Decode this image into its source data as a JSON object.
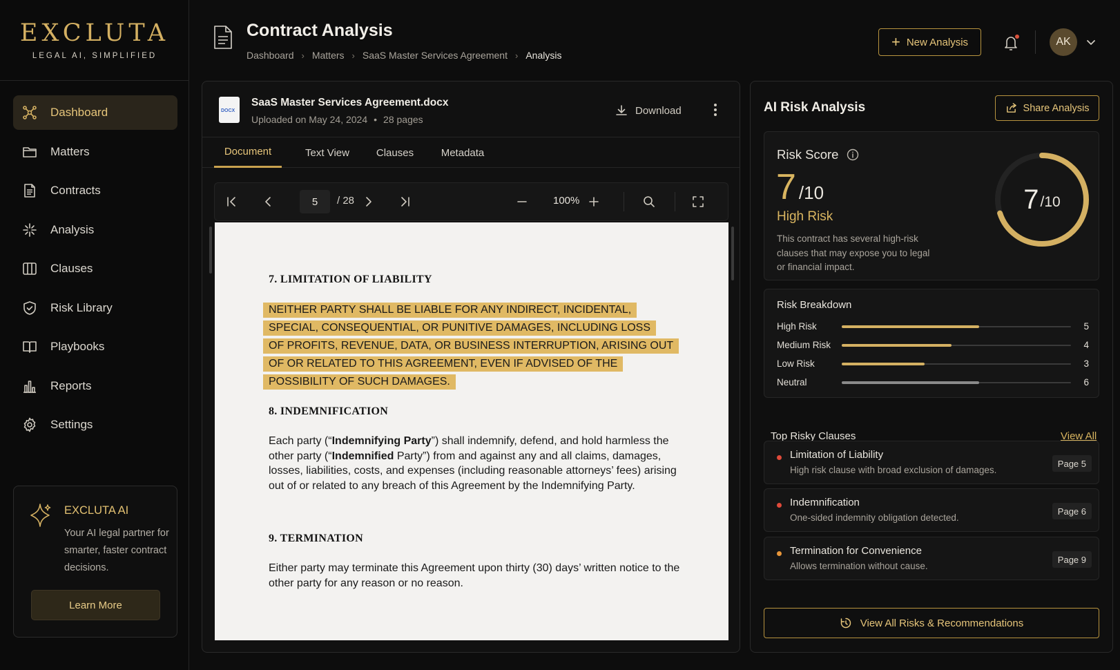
{
  "brand": {
    "name": "EXCLUTA",
    "tagline": "LEGAL AI, SIMPLIFIED"
  },
  "sidebar": {
    "items": [
      {
        "label": "Dashboard",
        "icon": "dashboard-icon",
        "active": true
      },
      {
        "label": "Matters",
        "icon": "folder-icon"
      },
      {
        "label": "Contracts",
        "icon": "document-icon"
      },
      {
        "label": "Analysis",
        "icon": "sparkle-icon"
      },
      {
        "label": "Clauses",
        "icon": "columns-icon"
      },
      {
        "label": "Risk Library",
        "icon": "shield-icon"
      },
      {
        "label": "Playbooks",
        "icon": "book-icon"
      },
      {
        "label": "Reports",
        "icon": "bar-chart-icon"
      },
      {
        "label": "Settings",
        "icon": "gear-icon"
      }
    ],
    "promo": {
      "title": "EXCLUTA AI",
      "text": "Your AI legal partner for smarter, faster contract decisions.",
      "button": "Learn More"
    }
  },
  "header": {
    "title": "Contract Analysis",
    "breadcrumb": [
      "Dashboard",
      "Matters",
      "SaaS Master Services Agreement",
      "Analysis"
    ],
    "new_button": "New Analysis",
    "avatar_initials": "AK"
  },
  "document": {
    "file_name": "SaaS Master Services Agreement.docx",
    "file_type": "DOCX",
    "uploaded": "Uploaded on May 24, 2024",
    "pages": "28 pages",
    "download_label": "Download",
    "tabs": [
      "Document",
      "Text View",
      "Clauses",
      "Metadata"
    ],
    "active_tab": "Document",
    "pager": {
      "current_page": "5",
      "total": "/ 28",
      "zoom": "100%"
    },
    "content": {
      "s7_heading": "7. LIMITATION OF LIABILITY",
      "s7_highlight": [
        "NEITHER PARTY SHALL BE LIABLE FOR ANY INDIRECT, INCIDENTAL,",
        "SPECIAL, CONSEQUENTIAL, OR PUNITIVE DAMAGES, INCLUDING LOSS",
        "OF PROFITS, REVENUE, DATA, OR BUSINESS INTERRUPTION, ARISING OUT",
        "OF OR RELATED TO THIS AGREEMENT, EVEN IF ADVISED OF THE",
        "POSSIBILITY OF SUCH DAMAGES."
      ],
      "s8_heading": "8. INDEMNIFICATION",
      "s8_p1": "Each party (“",
      "s8_b1": "Indemnifying Party",
      "s8_p2": "”) shall indemnify, defend, and hold harmless the other party (“",
      "s8_b2": "Indemnified",
      "s8_p3": " Party”) from and against any and all claims, damages, losses, liabilities, costs, and expenses (including reasonable attorneys’ fees) arising out of or related to any breach of this Agreement by the Indemnifying Party.",
      "s9_heading": "9. TERMINATION",
      "s9_text": "Either party may terminate this Agreement upon thirty (30) days’ written notice to the other party for any reason or no reason."
    }
  },
  "risk": {
    "title": "AI Risk Analysis",
    "share_button": "Share Analysis",
    "score_label": "Risk Score",
    "score": "7",
    "score_max": "/10",
    "score_value": 7,
    "score_total": 10,
    "level": "High Risk",
    "description": "This contract has several high-risk clauses that may expose you to legal or financial impact.",
    "breakdown_title": "Risk Breakdown",
    "breakdown": [
      {
        "label": "High Risk",
        "value": "5",
        "fraction": 0.6,
        "color": "#d4b062"
      },
      {
        "label": "Medium Risk",
        "value": "4",
        "fraction": 0.48,
        "color": "#d4b062"
      },
      {
        "label": "Low Risk",
        "value": "3",
        "fraction": 0.36,
        "color": "#d4b062"
      },
      {
        "label": "Neutral",
        "value": "6",
        "fraction": 0.6,
        "color": "#8a8a8a"
      }
    ],
    "top_title": "Top Risky Clauses",
    "view_all": "View All",
    "clauses": [
      {
        "title": "Limitation of Liability",
        "desc": "High risk clause with broad exclusion of damages.",
        "page": "Page 5",
        "color": "#e04a3a"
      },
      {
        "title": "Indemnification",
        "desc": "One-sided indemnity obligation detected.",
        "page": "Page 6",
        "color": "#e04a3a"
      },
      {
        "title": "Termination for Convenience",
        "desc": "Allows termination without cause.",
        "page": "Page 9",
        "color": "#e8963a"
      }
    ],
    "cta": "View All Risks & Recommendations",
    "accent": "#d4b062"
  }
}
